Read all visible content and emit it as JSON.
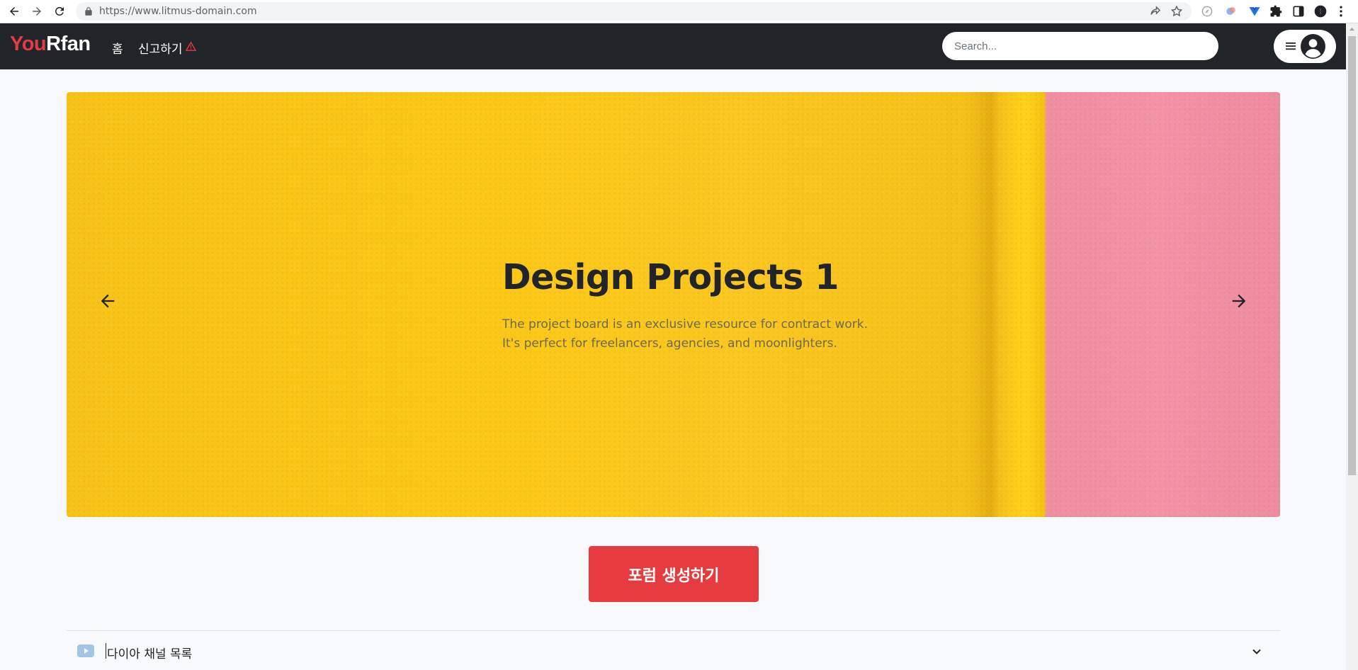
{
  "browser": {
    "url": "https://www.litmus-domain.com"
  },
  "navbar": {
    "brand_part1": "You",
    "brand_part2": "Rfan",
    "links": [
      {
        "label": "홈"
      },
      {
        "label": "신고하기"
      }
    ],
    "search_placeholder": "Search..."
  },
  "hero": {
    "title": "Design Projects 1",
    "description": "The project board is an exclusive resource for contract work. It's perfect for freelancers, agencies, and moonlighters."
  },
  "actions": {
    "create_forum_label": "포럼 생성하기"
  },
  "accordion": {
    "label": "다이아 채널 목록"
  },
  "colors": {
    "navbar_bg": "#212529",
    "brand_accent": "#e63946",
    "primary_button": "#e63c3f",
    "page_bg": "#f8f9fa"
  },
  "icons": {
    "back": "arrow-left-icon",
    "forward": "arrow-right-icon",
    "reload": "reload-icon",
    "lock": "lock-icon",
    "share": "share-icon",
    "star": "star-icon",
    "warning": "warning-triangle-icon",
    "menu": "hamburger-icon",
    "avatar": "user-circle-icon",
    "prev": "arrow-left-icon",
    "next": "arrow-right-icon",
    "youtube": "youtube-icon",
    "chevron": "chevron-down-icon"
  }
}
